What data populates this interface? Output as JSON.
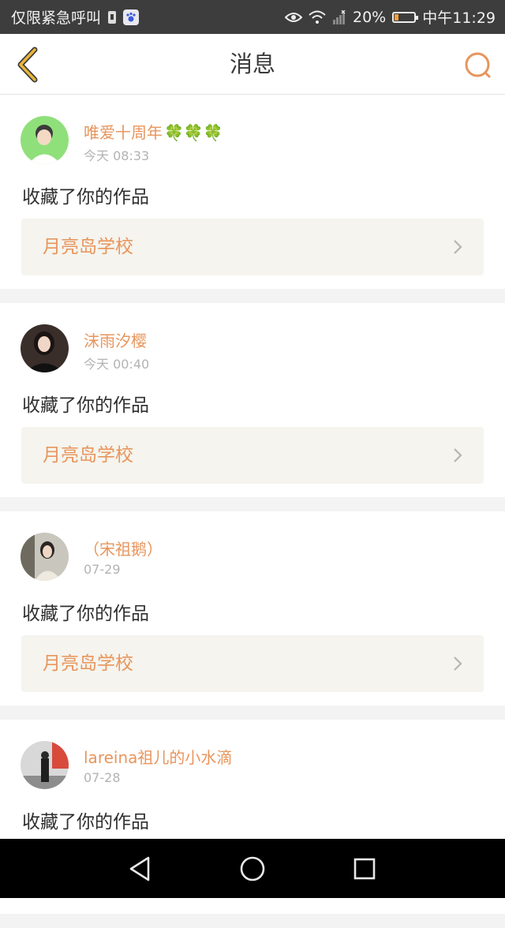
{
  "status_bar": {
    "emergency_text": "仅限紧急呼叫",
    "battery_percent": "20%",
    "battery_level": 0.2,
    "time": "中午11:29",
    "icons": [
      "sim-icon",
      "baidu-paw-icon",
      "eye-icon",
      "wifi-icon",
      "signal-icon",
      "battery-icon"
    ]
  },
  "header": {
    "title": "消息",
    "back_icon": "chevron-left-icon",
    "search_icon": "search-icon"
  },
  "messages": [
    {
      "username": "唯爱十周年",
      "username_emoji": "🍀🍀🍀",
      "time": "今天 08:33",
      "action": "收藏了你的作品",
      "work_title": "月亮岛学校"
    },
    {
      "username": "沫雨汐樱",
      "username_emoji": "",
      "time": "今天 00:40",
      "action": "收藏了你的作品",
      "work_title": "月亮岛学校"
    },
    {
      "username": "（宋祖鹅）",
      "username_emoji": "",
      "time": "07-29",
      "action": "收藏了你的作品",
      "work_title": "月亮岛学校"
    },
    {
      "username": "lareina祖儿的小水滴",
      "username_emoji": "",
      "time": "07-28",
      "action": "收藏了你的作品",
      "work_title": ""
    }
  ],
  "nav_bar": {
    "icons": [
      "back-triangle-icon",
      "home-circle-icon",
      "recents-square-icon"
    ]
  },
  "colors": {
    "accent": "#e8955c",
    "back_chevron": "#e8a23a",
    "status_bar_bg": "#3d3d3d",
    "card_link_bg": "#f5f4ee"
  }
}
